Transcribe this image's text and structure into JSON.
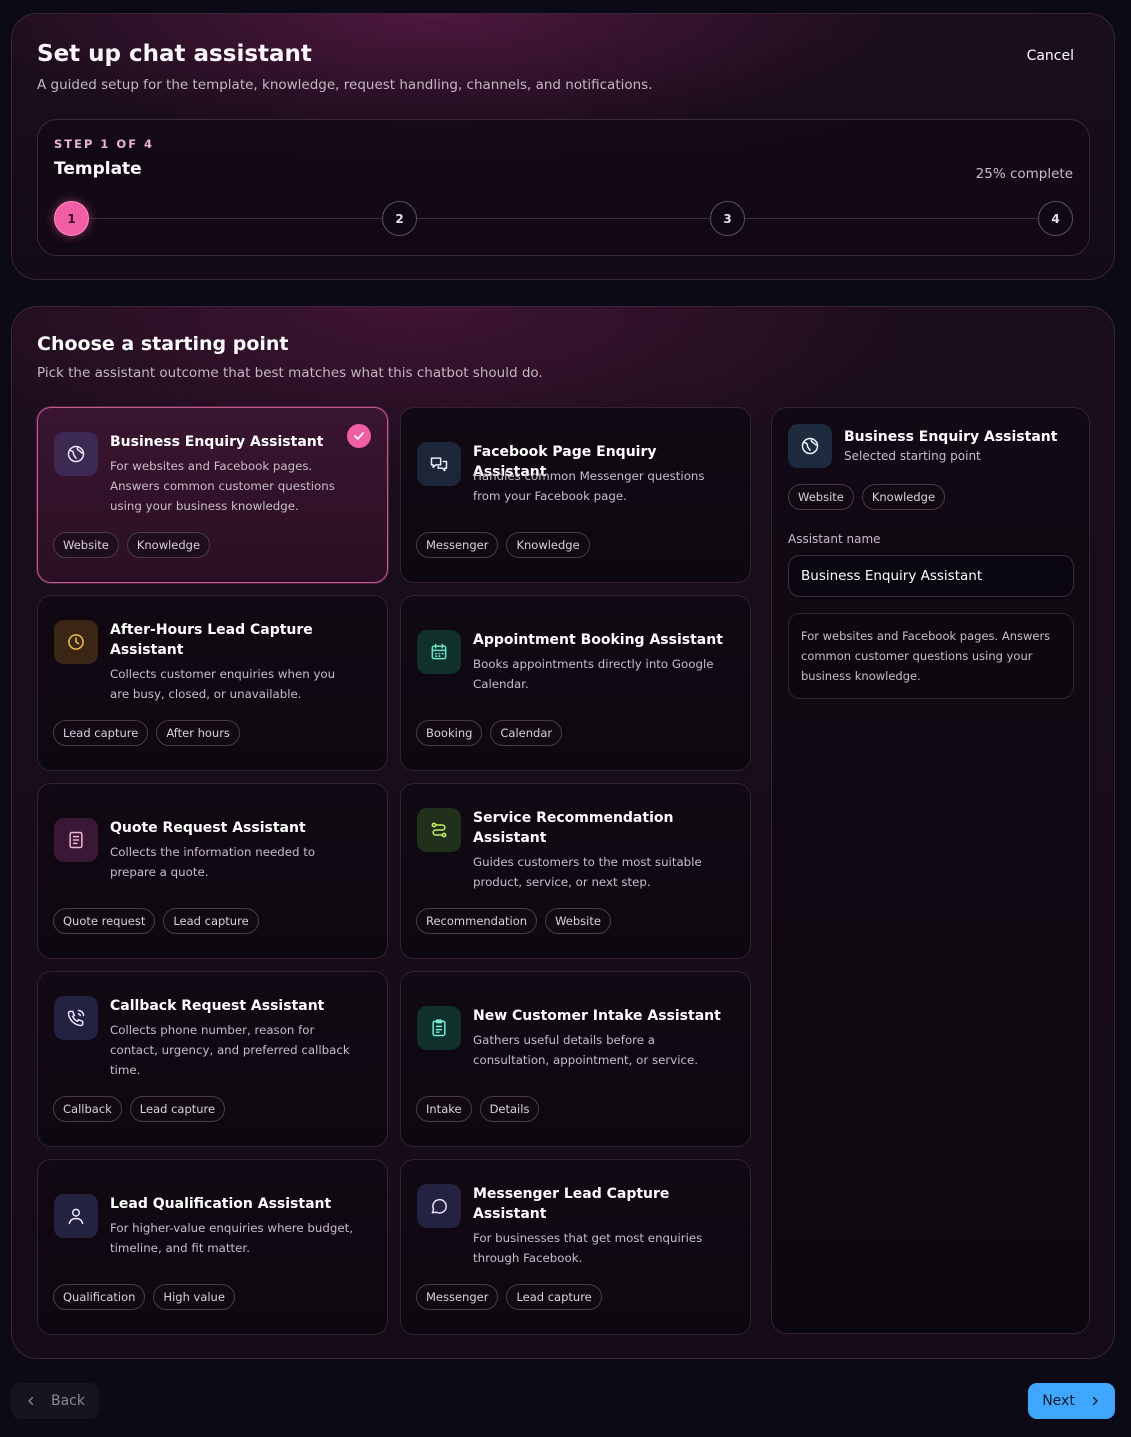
{
  "header": {
    "title": "Set up chat assistant",
    "subtitle": "A guided setup for the template, knowledge, request handling, channels, and notifications.",
    "cancel_label": "Cancel"
  },
  "stepper": {
    "kicker": "STEP 1 OF 4",
    "current_name": "Template",
    "progress_text": "25% complete",
    "progress_fraction": 0.25,
    "steps": [
      "1",
      "2",
      "3",
      "4"
    ],
    "active_step": 1
  },
  "section": {
    "title": "Choose a starting point",
    "subtitle": "Pick the assistant outcome that best matches what this chatbot should do."
  },
  "templates": [
    {
      "title": "Business Enquiry Assistant",
      "desc": "For websites and Facebook pages. Answers common customer questions using your business knowledge.",
      "tags": [
        "Website",
        "Knowledge"
      ],
      "icon": "globe-icon",
      "selected": true
    },
    {
      "title": "Facebook Page Enquiry Assistant",
      "desc": "Handles common Messenger questions from your Facebook page.",
      "tags": [
        "Messenger",
        "Knowledge"
      ],
      "icon": "chat-bubbles-icon",
      "selected": false
    },
    {
      "title": "After-Hours Lead Capture Assistant",
      "desc": "Collects customer enquiries when you are busy, closed, or unavailable.",
      "tags": [
        "Lead capture",
        "After hours"
      ],
      "icon": "clock-icon",
      "selected": false
    },
    {
      "title": "Appointment Booking Assistant",
      "desc": "Books appointments directly into Google Calendar.",
      "tags": [
        "Booking",
        "Calendar"
      ],
      "icon": "calendar-icon",
      "selected": false
    },
    {
      "title": "Quote Request Assistant",
      "desc": "Collects the information needed to prepare a quote.",
      "tags": [
        "Quote request",
        "Lead capture"
      ],
      "icon": "document-icon",
      "selected": false
    },
    {
      "title": "Service Recommendation Assistant",
      "desc": "Guides customers to the most suitable product, service, or next step.",
      "tags": [
        "Recommendation",
        "Website"
      ],
      "icon": "route-icon",
      "selected": false
    },
    {
      "title": "Callback Request Assistant",
      "desc": "Collects phone number, reason for contact, urgency, and preferred callback time.",
      "tags": [
        "Callback",
        "Lead capture"
      ],
      "icon": "phone-icon",
      "selected": false
    },
    {
      "title": "New Customer Intake Assistant",
      "desc": "Gathers useful details before a consultation, appointment, or service.",
      "tags": [
        "Intake",
        "Details"
      ],
      "icon": "clipboard-icon",
      "selected": false
    },
    {
      "title": "Lead Qualification Assistant",
      "desc": "For higher-value enquiries where budget, timeline, and fit matter.",
      "tags": [
        "Qualification",
        "High value"
      ],
      "icon": "user-icon",
      "selected": false
    },
    {
      "title": "Messenger Lead Capture Assistant",
      "desc": "For businesses that get most enquiries through Facebook.",
      "tags": [
        "Messenger",
        "Lead capture"
      ],
      "icon": "message-circle-icon",
      "selected": false
    }
  ],
  "summary": {
    "title": "Business Enquiry Assistant",
    "subtitle": "Selected starting point",
    "tags": [
      "Website",
      "Knowledge"
    ],
    "name_label": "Assistant name",
    "name_value": "Business Enquiry Assistant",
    "description": "For websites and Facebook pages. Answers common customer questions using your business knowledge."
  },
  "footer": {
    "back_label": "Back",
    "next_label": "Next"
  },
  "colors": {
    "accent_pink": "#f25ea3",
    "next_blue": "#3fa7ff"
  }
}
